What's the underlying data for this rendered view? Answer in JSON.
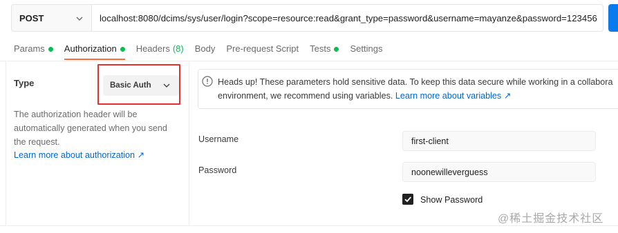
{
  "request": {
    "method": "POST",
    "url": "localhost:8080/dcims/sys/user/login?scope=resource:read&grant_type=password&username=mayanze&password=123456"
  },
  "tabs": [
    {
      "label": "Params",
      "dot": true
    },
    {
      "label": "Authorization",
      "dot": true,
      "active": true
    },
    {
      "label": "Headers",
      "count": "(8)"
    },
    {
      "label": "Body"
    },
    {
      "label": "Pre-request Script"
    },
    {
      "label": "Tests",
      "dot": true
    },
    {
      "label": "Settings"
    }
  ],
  "auth": {
    "type_label": "Type",
    "type_value": "Basic Auth",
    "description": "The authorization header will be automatically generated when you send the request.",
    "learn_more": "Learn more about authorization ↗"
  },
  "notice": {
    "line1": "Heads up! These parameters hold sensitive data. To keep this data secure while working in a collabora",
    "line2": "environment, we recommend using variables.",
    "link": "Learn more about variables ↗"
  },
  "fields": {
    "username_label": "Username",
    "username_value": "first-client",
    "password_label": "Password",
    "password_value": "noonewilleverguess",
    "show_password_label": "Show Password",
    "show_password_checked": true
  },
  "watermark": "@稀土掘金技术社区",
  "colors": {
    "accent": "#ff6c37",
    "status_green": "#0cbb52",
    "link_blue": "#0265d2",
    "send_blue": "#097bed",
    "highlight_red": "#e3312d"
  }
}
